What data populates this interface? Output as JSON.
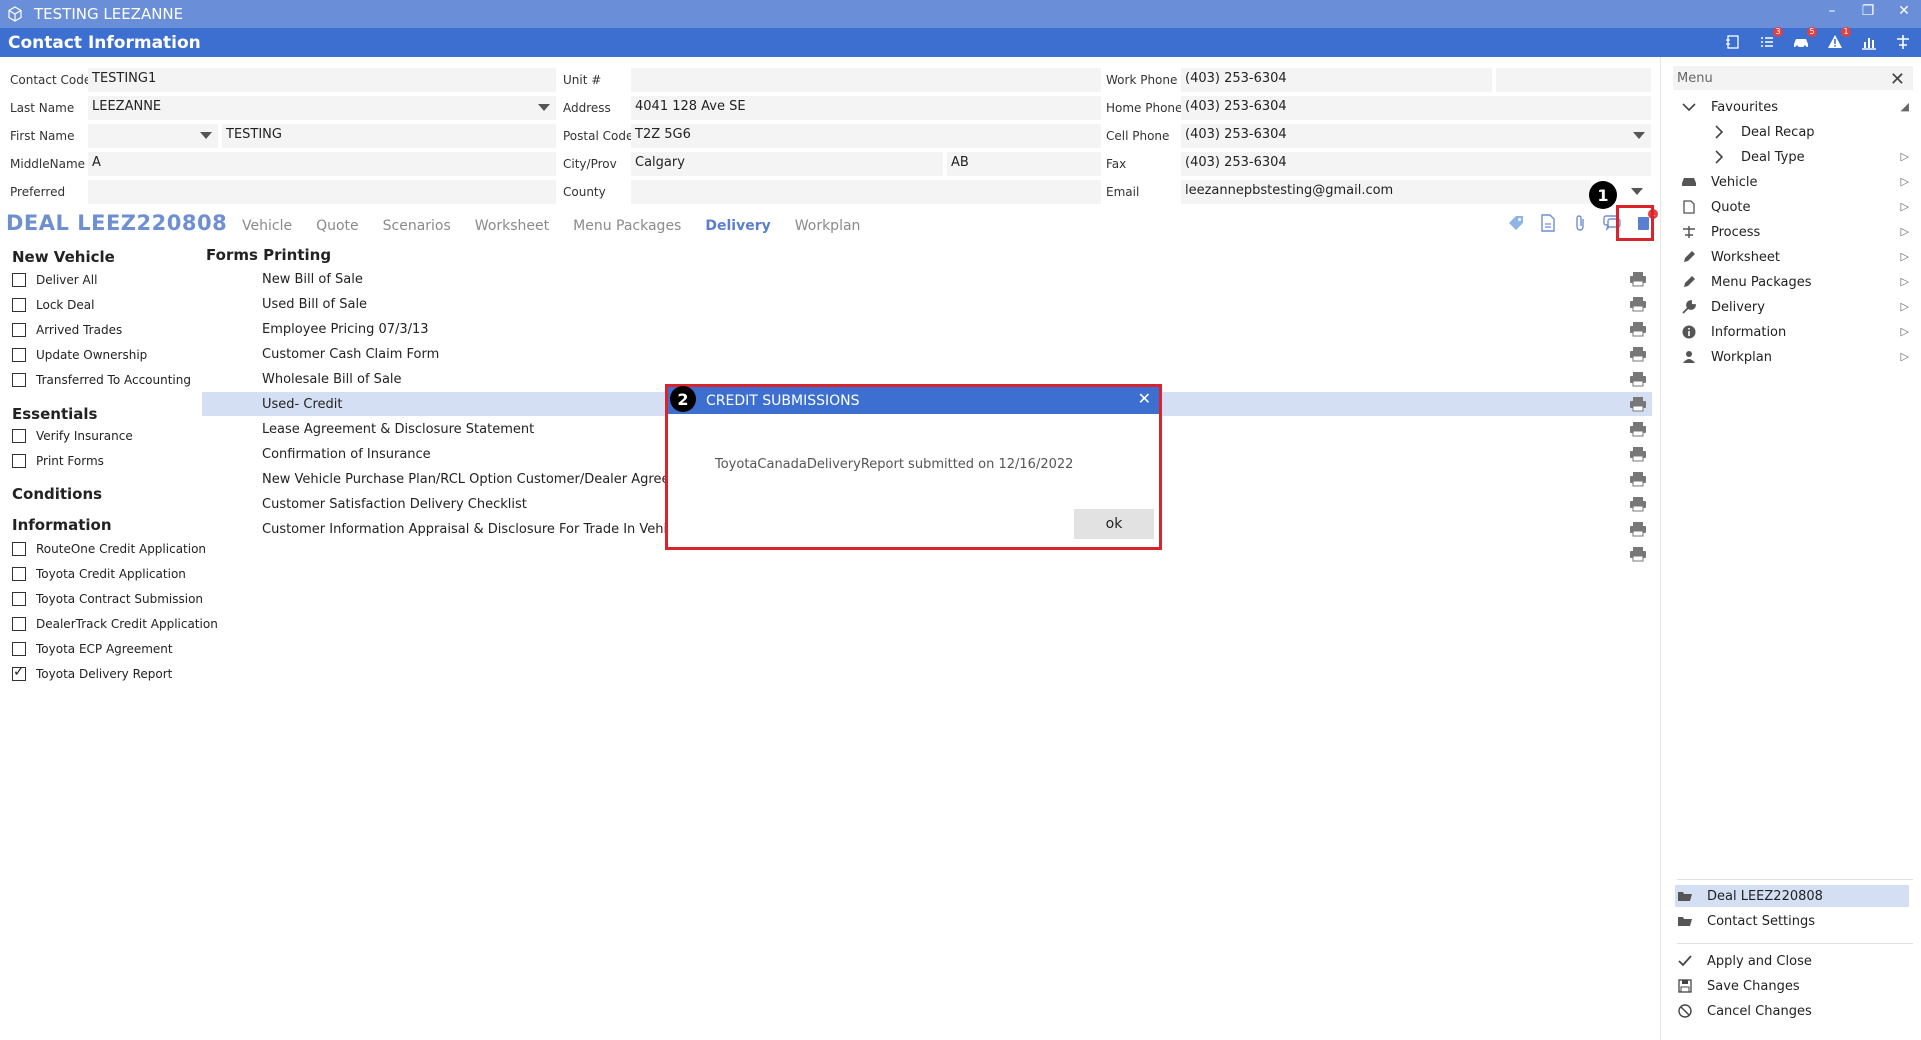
{
  "window": {
    "title": "TESTING LEEZANNE",
    "minimize": "–",
    "restore": "❐",
    "close": "✕"
  },
  "header": {
    "title": "Contact Information",
    "badges": {
      "tasks": "3",
      "vehicle": "5",
      "alerts": "1"
    }
  },
  "contact": {
    "labels": {
      "contact_code": "Contact Code",
      "last_name": "Last Name",
      "first_name": "First Name",
      "middle_name": "MiddleName",
      "preferred": "Preferred",
      "unit": "Unit #",
      "address": "Address",
      "postal_code": "Postal Code",
      "city_prov": "City/Prov",
      "county": "County",
      "work_phone": "Work Phone",
      "home_phone": "Home Phone",
      "cell_phone": "Cell Phone",
      "fax": "Fax",
      "email": "Email"
    },
    "values": {
      "contact_code": "TESTING1",
      "last_name": "LEEZANNE",
      "salutation": "",
      "first_name": "TESTING",
      "middle_name": "A",
      "preferred": "",
      "unit": "",
      "address": "4041 128 Ave SE",
      "postal_code": "T2Z 5G6",
      "city": "Calgary",
      "province": "AB",
      "county": "",
      "work_phone": "(403) 253-6304",
      "work_ext": "",
      "home_phone": "(403) 253-6304",
      "cell_phone": "(403) 253-6304",
      "fax": "(403) 253-6304",
      "email": "leezannepbstesting@gmail.com"
    }
  },
  "deal": {
    "title": "DEAL LEEZ220808",
    "tabs": [
      "Vehicle",
      "Quote",
      "Scenarios",
      "Worksheet",
      "Menu Packages",
      "Delivery",
      "Workplan"
    ],
    "active_tab": "Delivery",
    "notification_badge": "1"
  },
  "markers": {
    "one": "1",
    "two": "2"
  },
  "checklist": {
    "sections": [
      {
        "title": "New Vehicle",
        "items": [
          {
            "label": "Deliver All",
            "checked": false
          },
          {
            "label": "Lock Deal",
            "checked": false
          },
          {
            "label": "Arrived Trades",
            "checked": false
          },
          {
            "label": "Update Ownership",
            "checked": false
          },
          {
            "label": "Transferred To Accounting",
            "checked": false
          }
        ]
      },
      {
        "title": "Essentials",
        "items": [
          {
            "label": "Verify Insurance",
            "checked": false
          },
          {
            "label": "Print Forms",
            "checked": false
          }
        ]
      },
      {
        "title": "Conditions",
        "items": []
      },
      {
        "title": "Information",
        "items": [
          {
            "label": "RouteOne Credit Application",
            "checked": false
          },
          {
            "label": "Toyota Credit Application",
            "checked": false
          },
          {
            "label": "Toyota Contract Submission",
            "checked": false
          },
          {
            "label": "DealerTrack Credit Application",
            "checked": false
          },
          {
            "label": "Toyota ECP Agreement",
            "checked": false
          },
          {
            "label": "Toyota Delivery Report",
            "checked": true
          }
        ]
      }
    ]
  },
  "forms": {
    "title": "Forms Printing",
    "items": [
      "New Bill of Sale",
      "Used Bill of Sale",
      "Employee Pricing 07/3/13",
      "Customer Cash Claim Form",
      "Wholesale Bill of Sale",
      "Used- Credit",
      "Lease Agreement & Disclosure Statement",
      "Confirmation of Insurance",
      "New Vehicle Purchase Plan/RCL Option Customer/Dealer Agreement",
      "Customer Satisfaction Delivery Checklist",
      "Customer Information Appraisal & Disclosure For Trade In Vehicles",
      ""
    ],
    "selected_index": 5
  },
  "menu": {
    "title": "Menu",
    "favourites": "Favourites",
    "favourite_items": [
      "Deal Recap",
      "Deal Type"
    ],
    "items": [
      "Vehicle",
      "Quote",
      "Process",
      "Worksheet",
      "Menu Packages",
      "Delivery",
      "Information",
      "Workplan"
    ],
    "bottom": [
      "Deal LEEZ220808",
      "Contact Settings"
    ],
    "actions": [
      "Apply and Close",
      "Save Changes",
      "Cancel Changes"
    ]
  },
  "modal": {
    "title": "CREDIT SUBMISSIONS",
    "message": "ToyotaCanadaDeliveryReport submitted on 12/16/2022",
    "ok_label": "ok"
  },
  "colors": {
    "accent": "#3d6fd1",
    "titlebar": "#6a8fd8",
    "highlight": "#d9232d",
    "selected": "#d5dff3"
  }
}
